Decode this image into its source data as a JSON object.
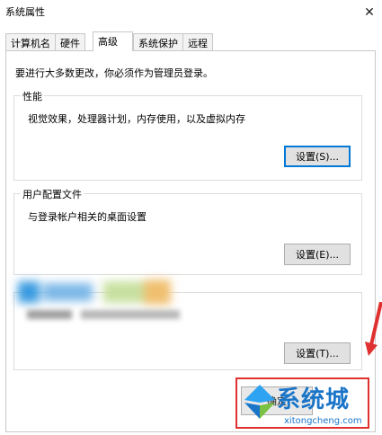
{
  "window": {
    "title": "系统属性",
    "close_glyph": "✕"
  },
  "tabs": [
    {
      "label": "计算机名",
      "active": false
    },
    {
      "label": "硬件",
      "active": false
    },
    {
      "label": "高级",
      "active": true
    },
    {
      "label": "系统保护",
      "active": false
    },
    {
      "label": "远程",
      "active": false
    }
  ],
  "notice": "要进行大多数更改，你必须作为管理员登录。",
  "performance": {
    "title": "性能",
    "description": "视觉效果，处理器计划，内存使用，以及虚拟内存",
    "button": "设置(S)..."
  },
  "user_profiles": {
    "title": "用户配置文件",
    "description": "与登录帐户相关的桌面设置",
    "button": "设置(E)..."
  },
  "startup_recovery": {
    "button": "设置(T)..."
  },
  "footer": {
    "ok_button": "确定"
  },
  "watermark": {
    "brand": "系统城",
    "url": "xitongcheng.com"
  },
  "colors": {
    "focus": "#0078d7",
    "highlight_red": "#e03030",
    "watermark_blue": "#1a75c8"
  }
}
